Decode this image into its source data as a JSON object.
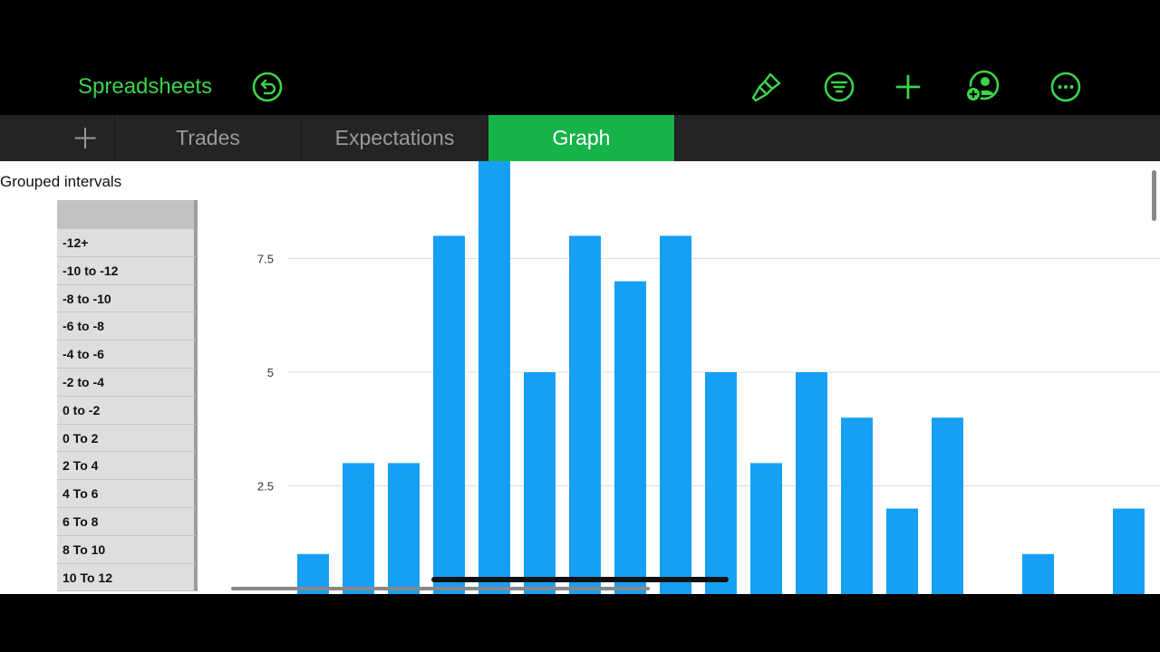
{
  "toolbar": {
    "back_label": "Spreadsheets",
    "icons": [
      "undo-icon",
      "paintbrush-icon",
      "format-list-icon",
      "plus-icon",
      "collaborate-icon",
      "more-icon"
    ],
    "accent": "#3cd34b"
  },
  "tabs": [
    {
      "label": "Trades",
      "active": false
    },
    {
      "label": "Expectations",
      "active": false
    },
    {
      "label": "Graph",
      "active": true
    }
  ],
  "table": {
    "title": "Grouped intervals",
    "rows": [
      "-12+",
      "-10 to -12",
      "-8 to -10",
      "-6 to -8",
      "-4 to -6",
      "-2 to -4",
      "0 to -2",
      "0 To 2",
      "2 To 4",
      "4 To 6",
      "6 To 8",
      "8 To 10",
      "10 To 12"
    ]
  },
  "chart_data": {
    "type": "bar",
    "y_ticks": [
      "2.5",
      "5",
      "7.5"
    ],
    "values": [
      1,
      3,
      3,
      8,
      10,
      5,
      8,
      7,
      8,
      5,
      3,
      5,
      4,
      2,
      4,
      0,
      1,
      0,
      2
    ],
    "color": "#16a0f5",
    "grid": true
  }
}
